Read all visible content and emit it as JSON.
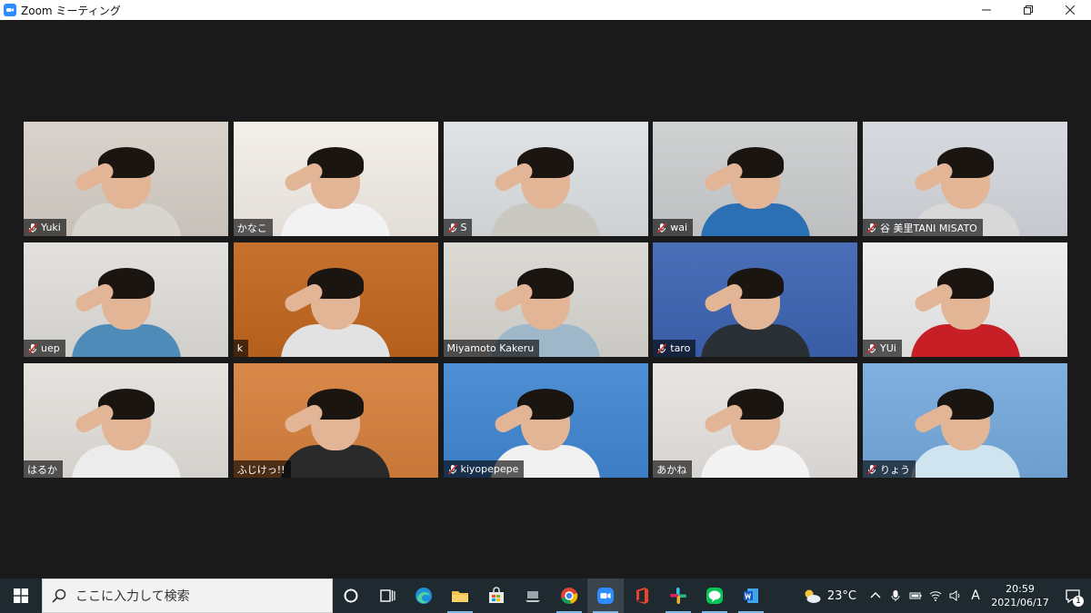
{
  "window": {
    "title": "Zoom ミーティング"
  },
  "participants": [
    {
      "name": "Yuki",
      "muted": true,
      "bg": "#d9d3cc",
      "shirt": "#d8d4d0"
    },
    {
      "name": "かなこ",
      "muted": false,
      "bg": "#f4efe9",
      "shirt": "#f2f2f2"
    },
    {
      "name": "S",
      "muted": true,
      "bg": "#dfe3e6",
      "shirt": "#c9c9c2"
    },
    {
      "name": "wai",
      "muted": true,
      "bg": "#cfd1d2",
      "shirt": "#2b6fb5"
    },
    {
      "name": "谷 美里TANI MISATO",
      "muted": true,
      "bg": "#d7dbe0",
      "shirt": "#d8d8d8"
    },
    {
      "name": "uep",
      "muted": true,
      "bg": "#e3e1de",
      "shirt": "#4f8bb8"
    },
    {
      "name": "k",
      "muted": false,
      "bg": "#c7712e",
      "shirt": "#e2e2e2"
    },
    {
      "name": "Miyamoto Kakeru",
      "muted": false,
      "bg": "#dcdad5",
      "shirt": "#9fb8c9"
    },
    {
      "name": "taro",
      "muted": true,
      "bg": "#4a6fb8",
      "shirt": "#2a2f35"
    },
    {
      "name": "YUi",
      "muted": true,
      "bg": "#eeeeee",
      "shirt": "#c81f26"
    },
    {
      "name": "はるか",
      "muted": false,
      "bg": "#e6e3df",
      "shirt": "#ececec"
    },
    {
      "name": "ふじけっ!!",
      "muted": false,
      "bg": "#d9894a",
      "shirt": "#2a2a2a",
      "active": true
    },
    {
      "name": "kiyopepepe",
      "muted": true,
      "bg": "#4e8fd6",
      "shirt": "#f0f0f0"
    },
    {
      "name": "あかね",
      "muted": false,
      "bg": "#e8e5e2",
      "shirt": "#f3f3f3"
    },
    {
      "name": "りょう",
      "muted": true,
      "bg": "#7fb0e0",
      "shirt": "#cfe4ee"
    }
  ],
  "taskbar": {
    "search_placeholder": "ここに入力して検索",
    "weather": "23°C",
    "ime": "A",
    "time": "20:59",
    "date": "2021/06/17",
    "notification_count": "1"
  },
  "colors": {
    "accent_zoom": "#2d8cff",
    "active_speaker": "#d4e87a",
    "taskbar": "#1f2a30"
  }
}
